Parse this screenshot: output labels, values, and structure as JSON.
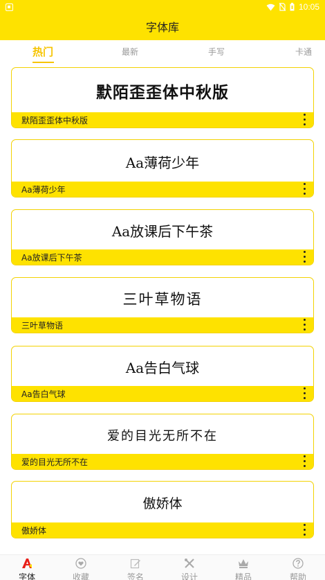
{
  "status": {
    "time": "10:05"
  },
  "header": {
    "title": "字体库"
  },
  "tabs": [
    {
      "label": "热门",
      "active": true
    },
    {
      "label": "最新",
      "active": false
    },
    {
      "label": "手写",
      "active": false
    },
    {
      "label": "卡通",
      "active": false
    }
  ],
  "fonts": [
    {
      "preview": "默陌歪歪体中秋版",
      "name": "默陌歪歪体中秋版"
    },
    {
      "preview": "Aa薄荷少年",
      "name": "Aa薄荷少年"
    },
    {
      "preview": "Aa放课后下午茶",
      "name": "Aa放课后下午茶"
    },
    {
      "preview": "三叶草物语",
      "name": "三叶草物语"
    },
    {
      "preview": "Aa告白气球",
      "name": "Aa告白气球"
    },
    {
      "preview": "爱的目光无所不在",
      "name": "爱的目光无所不在"
    },
    {
      "preview": "傲娇体",
      "name": "傲娇体"
    }
  ],
  "nav": [
    {
      "label": "字体",
      "icon": "font-a-icon",
      "active": true
    },
    {
      "label": "收藏",
      "icon": "heart-icon",
      "active": false
    },
    {
      "label": "签名",
      "icon": "edit-icon",
      "active": false
    },
    {
      "label": "设计",
      "icon": "tools-icon",
      "active": false
    },
    {
      "label": "精品",
      "icon": "crown-icon",
      "active": false
    },
    {
      "label": "帮助",
      "icon": "help-icon",
      "active": false
    }
  ],
  "colors": {
    "accent": "#FEE200",
    "active_tab": "#F6C400"
  }
}
